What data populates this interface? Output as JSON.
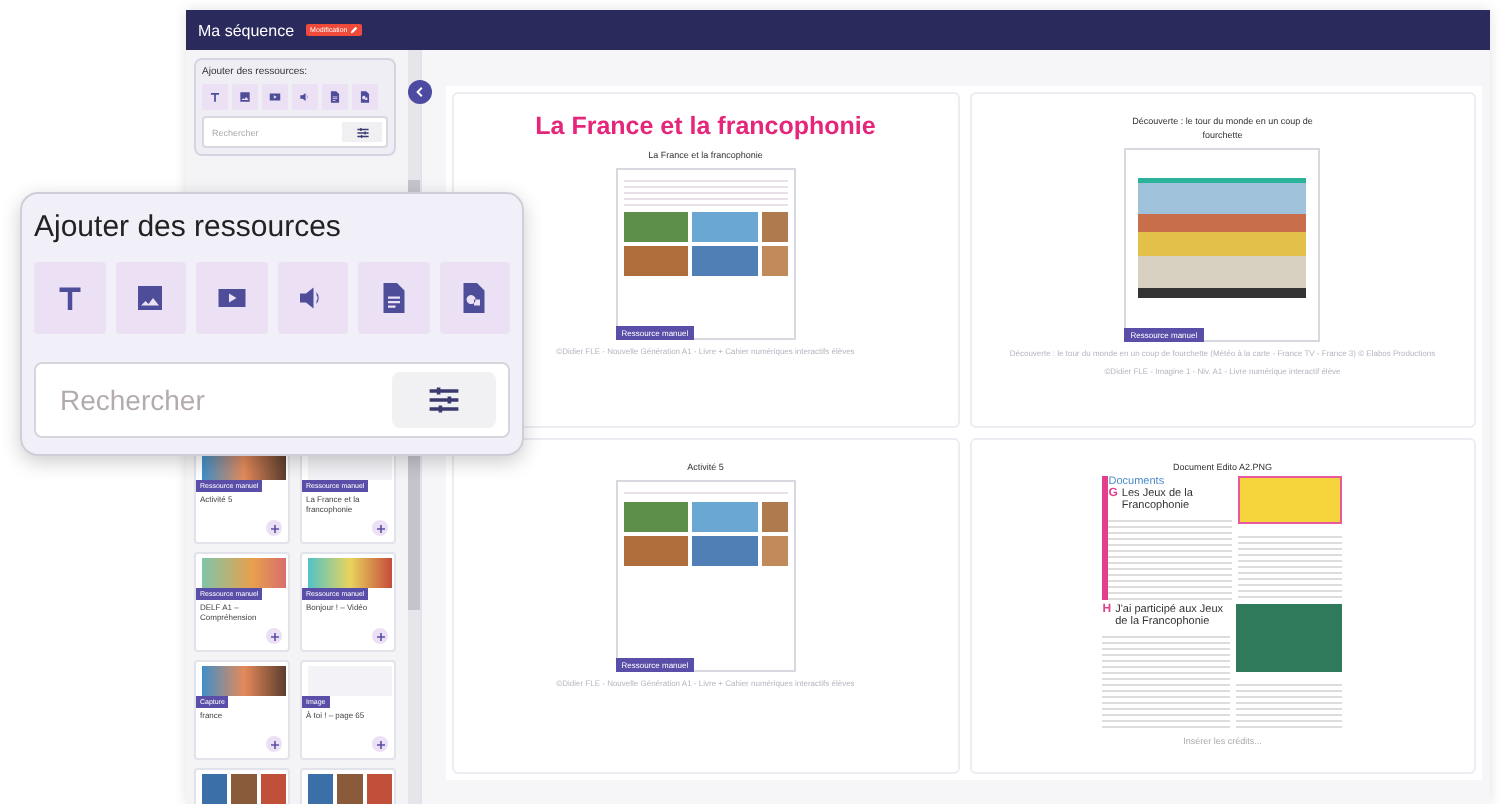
{
  "header": {
    "title": "Ma séquence",
    "badge": "Modification"
  },
  "sidebar": {
    "panel_title": "Ajouter des ressources:",
    "search": {
      "placeholder": "Rechercher"
    },
    "items": [
      {
        "badge": "Ressource manuel",
        "title": "Activité 5"
      },
      {
        "badge": "Ressource manuel",
        "title": "La France et la francophonie"
      },
      {
        "badge": "Ressource manuel",
        "title": "DELF A1 – Compréhension"
      },
      {
        "badge": "Ressource manuel",
        "title": "Bonjour ! – Vidéo"
      },
      {
        "badge": "Capture",
        "title": "france"
      },
      {
        "badge": "Image",
        "title": "À toi ! – page 65"
      },
      {
        "kind": "partial"
      },
      {
        "kind": "partial"
      }
    ]
  },
  "zoom_panel": {
    "title": "Ajouter des ressources",
    "search": {
      "placeholder": "Rechercher"
    }
  },
  "cards": [
    {
      "kind": "document",
      "heading": "La France et la francophonie",
      "title": "La France et la francophonie",
      "badge": "Ressource manuel",
      "captions": [
        "©Didier FLE - Nouvelle Génération A1 - Livre + Cahier numériques interactifs élèves"
      ]
    },
    {
      "kind": "video",
      "title": "Découverte : le tour du monde en un coup de fourchette",
      "badge": "Ressource manuel",
      "captions": [
        "Découverte : le tour du monde en un coup de fourchette (Météo à la carte - France TV - France 3) © Elabos Productions",
        "©Didier FLE - Imagine 1 - Niv. A1 - Livre numérique interactif élève"
      ]
    },
    {
      "kind": "activity",
      "title": "Activité 5",
      "badge": "Ressource manuel",
      "captions": [
        "©Didier FLE - Nouvelle Génération A1 - Livre + Cahier numériques interactifs élèves"
      ]
    },
    {
      "kind": "image",
      "title": "Document Edito A2.PNG",
      "image_texts": [
        "Documents",
        "G",
        "Les Jeux de la Francophonie",
        "H",
        "J'ai participé aux Jeux de la Francophonie"
      ],
      "credits": {
        "placeholder": "Insérer les crédits..."
      }
    }
  ]
}
